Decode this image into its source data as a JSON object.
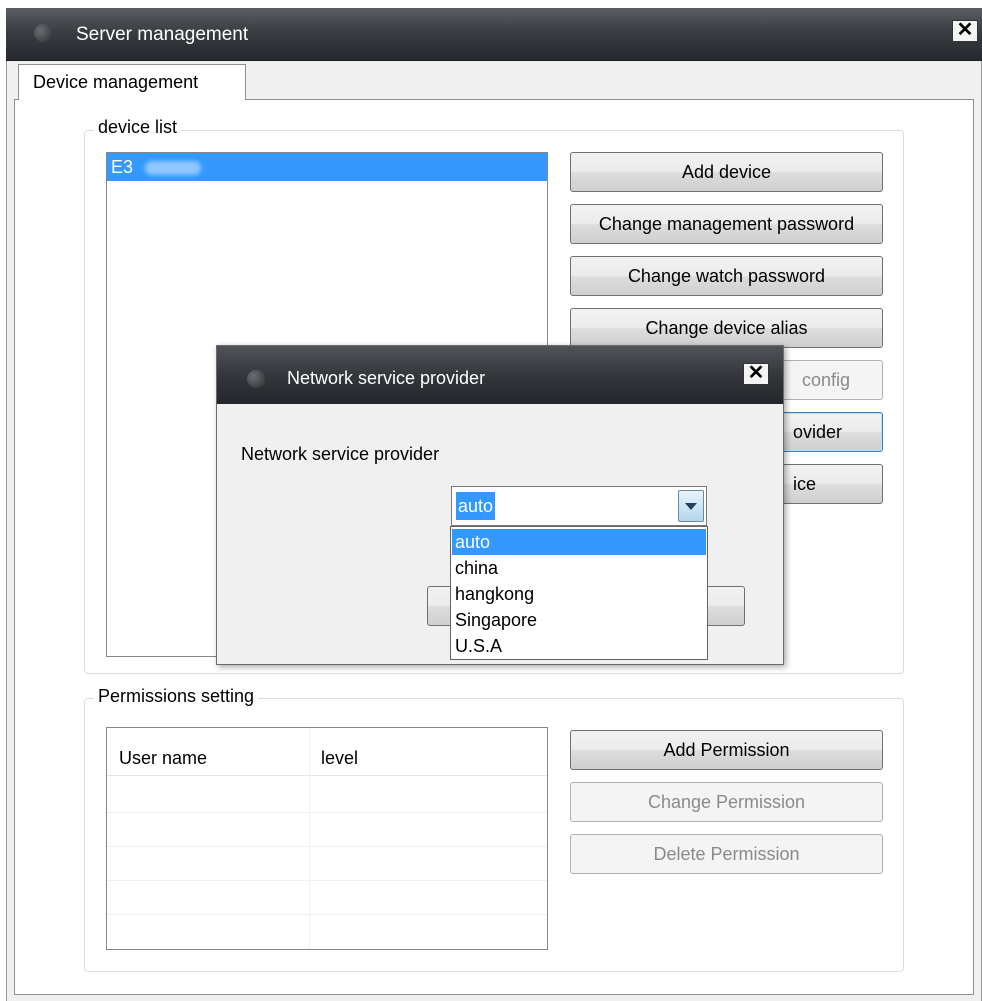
{
  "window": {
    "title": "Server management",
    "close_glyph": "✕"
  },
  "tabs": [
    {
      "label": "Device management"
    }
  ],
  "device_list": {
    "group_label": "device list",
    "items": [
      "E3"
    ]
  },
  "device_buttons": [
    {
      "label": "Add device",
      "enabled": true
    },
    {
      "label": "Change management password",
      "enabled": true
    },
    {
      "label": "Change watch password",
      "enabled": true
    },
    {
      "label": "Change device alias",
      "enabled": true
    },
    {
      "label": "config",
      "enabled": false
    },
    {
      "label": "ovider",
      "enabled": true
    },
    {
      "label": "ice",
      "enabled": true
    }
  ],
  "permissions": {
    "group_label": "Permissions setting",
    "columns": [
      "User name",
      "level"
    ],
    "rows": [],
    "buttons": [
      {
        "label": "Add Permission",
        "enabled": true
      },
      {
        "label": "Change Permission",
        "enabled": false
      },
      {
        "label": "Delete Permission",
        "enabled": false
      }
    ]
  },
  "dialog": {
    "title": "Network service provider",
    "field_label": "Network service provider",
    "combo_value": "auto",
    "options": [
      "auto",
      "china",
      "hangkong",
      "Singapore",
      "U.S.A"
    ],
    "selected_option": "auto"
  },
  "colors": {
    "selection": "#3399ff",
    "titlebar": "#2c2f33",
    "disabled_text": "#8a8a8a"
  }
}
